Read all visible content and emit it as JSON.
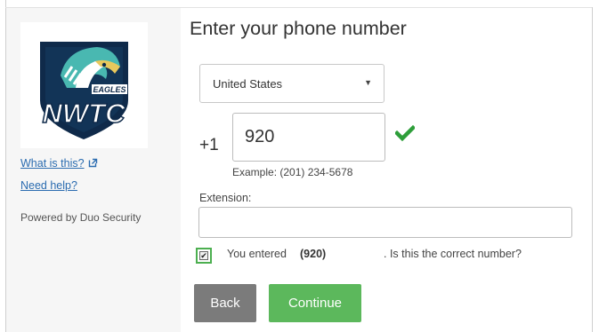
{
  "sidebar": {
    "logo": {
      "icon": "eagle-logo",
      "wordmark_small": "EAGLES",
      "wordmark_large": "NWTC",
      "colors": {
        "navy": "#0f2a4a",
        "teal": "#49b8b1",
        "white": "#ffffff"
      }
    },
    "links": [
      {
        "label": "What is this?",
        "icon": "external-link-icon"
      },
      {
        "label": "Need help?"
      }
    ],
    "powered_by": "Powered by Duo Security"
  },
  "main": {
    "title": "Enter your phone number",
    "country_select": {
      "value": "United States",
      "icon": "dropdown-arrow-icon"
    },
    "phone": {
      "prefix": "+1",
      "value": "920",
      "example": "Example: (201) 234-5678",
      "valid_icon": "checkmark-icon"
    },
    "extension": {
      "label": "Extension:",
      "value": ""
    },
    "confirmation": {
      "checked": true,
      "text_before": "You entered",
      "number": "(920)",
      "text_after": ". Is this the correct number?"
    },
    "buttons": {
      "back": "Back",
      "continue": "Continue"
    }
  },
  "colors": {
    "link": "#2b6cb0",
    "success": "#5cb85c",
    "check_green": "#2e9e3a",
    "back_button": "#7b7b7b",
    "sidebar_bg": "#f6f6f6"
  }
}
